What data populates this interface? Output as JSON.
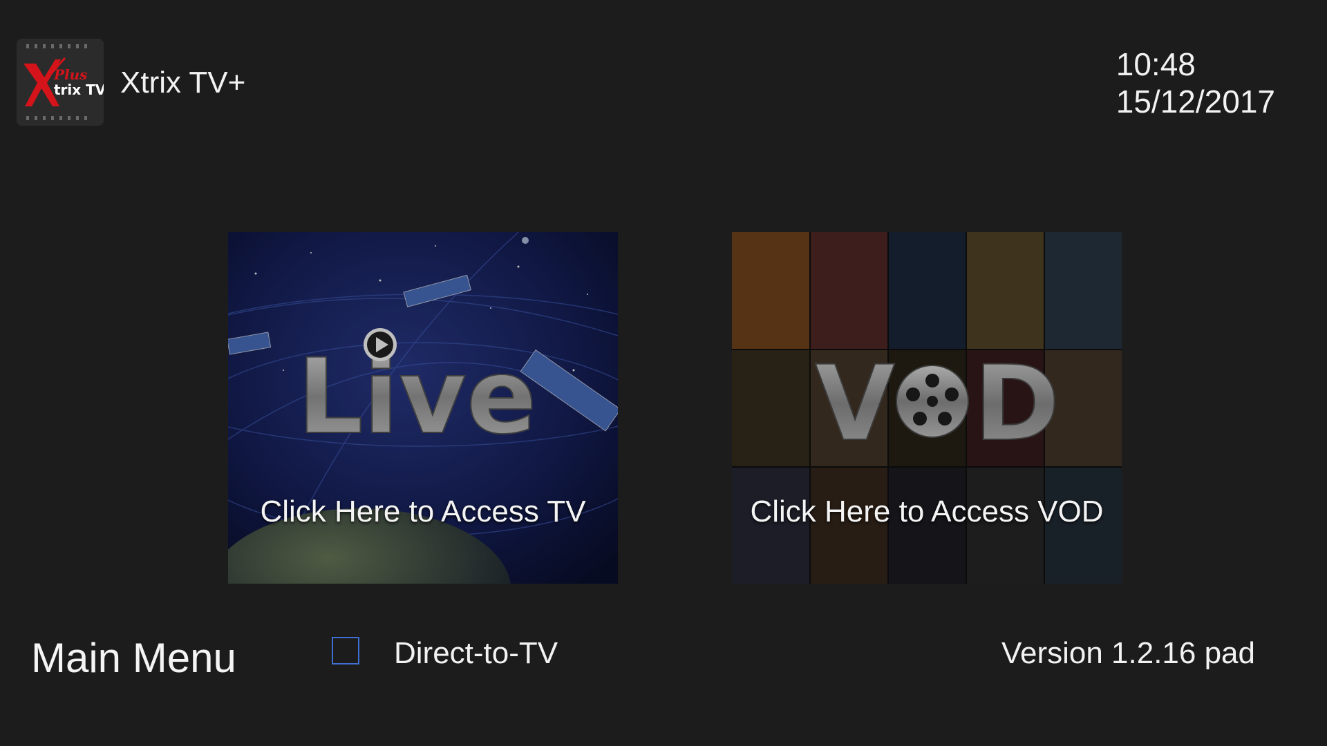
{
  "header": {
    "app_title": "Xtrix TV+",
    "time": "10:48",
    "date": "15/12/2017",
    "logo": {
      "icon": "xtrix-tv-logo",
      "text_plus": "Plus",
      "text_main": "trix TV"
    }
  },
  "tiles": [
    {
      "id": "live",
      "icon": "live-tv-artwork",
      "caption": "Click Here to Access TV"
    },
    {
      "id": "vod",
      "icon": "vod-poster-collage",
      "caption": "Click Here to Access VOD"
    }
  ],
  "footer": {
    "title": "Main Menu",
    "direct_to_tv_label": "Direct-to-TV",
    "direct_to_tv_checked": false,
    "version": "Version 1.2.16 pad"
  },
  "colors": {
    "background": "#1c1c1c",
    "checkbox_border": "#3f6fd0",
    "logo_red": "#d4141a"
  }
}
